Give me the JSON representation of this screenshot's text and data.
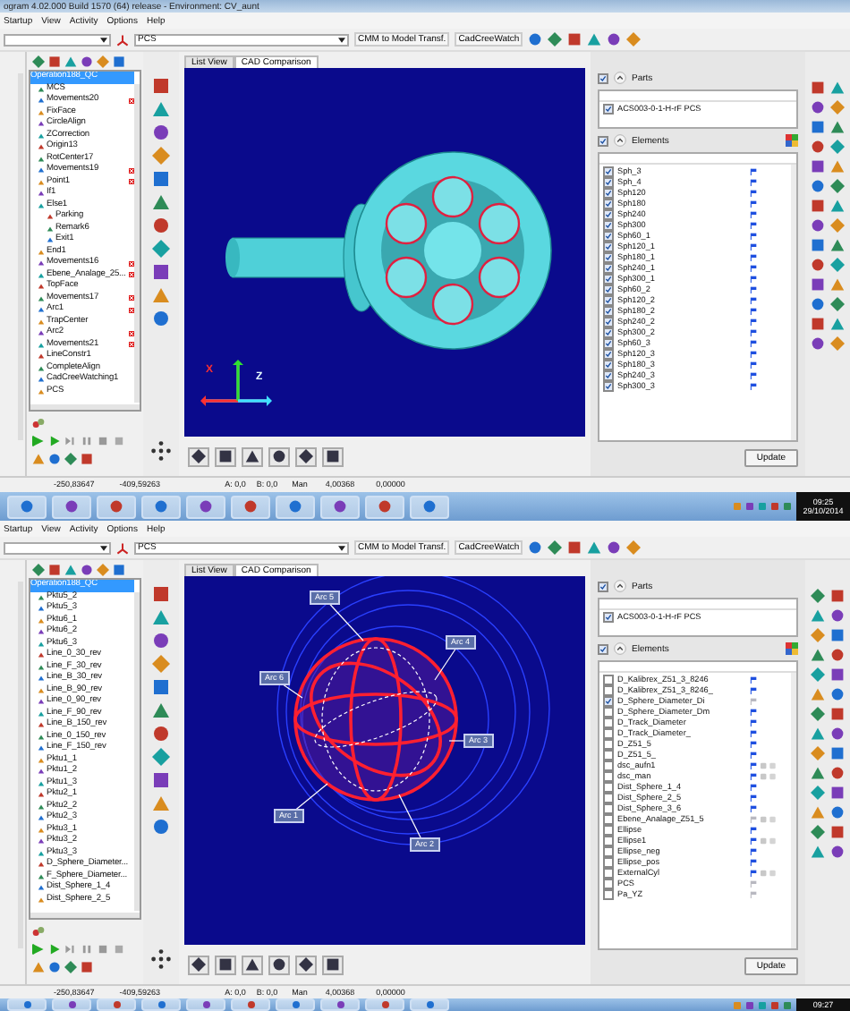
{
  "screens": [
    {
      "title": "ogram 4.02.000 Build 1570 (64) release - Environment: CV_aunt",
      "menu": [
        "Startup",
        "View",
        "Activity",
        "Options",
        "Help"
      ],
      "toolbar": {
        "coordinate_system": "PCS",
        "buttons": [
          "CMM to Model Transf.",
          "CadCreeWatch"
        ]
      },
      "tree": {
        "items": [
          {
            "label": "Operation188_QC",
            "selected": true,
            "warning": false,
            "children": [
              {
                "label": "MCS",
                "selected": false,
                "warning": false
              },
              {
                "label": "Movements20",
                "selected": false,
                "warning": true
              },
              {
                "label": "FixFace",
                "selected": false,
                "warning": false
              },
              {
                "label": "CircleAlign",
                "selected": false,
                "warning": false
              },
              {
                "label": "ZCorrection",
                "selected": false,
                "warning": false
              },
              {
                "label": "Origin13",
                "selected": false,
                "warning": false
              },
              {
                "label": "RotCenter17",
                "selected": false,
                "warning": false
              },
              {
                "label": "Movements19",
                "selected": false,
                "warning": true
              },
              {
                "label": "Point1",
                "selected": false,
                "warning": true
              },
              {
                "label": "If1",
                "selected": false,
                "warning": false
              },
              {
                "label": "Else1",
                "selected": false,
                "warning": false,
                "children": [
                  {
                    "label": "Parking",
                    "selected": false,
                    "warning": false
                  },
                  {
                    "label": "Remark6",
                    "selected": false,
                    "warning": false
                  },
                  {
                    "label": "Exit1",
                    "selected": false,
                    "warning": false
                  }
                ]
              },
              {
                "label": "End1",
                "selected": false,
                "warning": false
              },
              {
                "label": "Movements16",
                "selected": false,
                "warning": true
              },
              {
                "label": "Ebene_Analage_25...",
                "selected": false,
                "warning": true
              },
              {
                "label": "TopFace",
                "selected": false,
                "warning": false
              },
              {
                "label": "Movements17",
                "selected": false,
                "warning": true
              },
              {
                "label": "Arc1",
                "selected": false,
                "warning": true
              },
              {
                "label": "TrapCenter",
                "selected": false,
                "warning": false
              },
              {
                "label": "Arc2",
                "selected": false,
                "warning": true
              },
              {
                "label": "Movements21",
                "selected": false,
                "warning": true
              },
              {
                "label": "LineConstr1",
                "selected": false,
                "warning": false
              },
              {
                "label": "CompleteAlign",
                "selected": false,
                "warning": false
              },
              {
                "label": "CadCreeWatching1",
                "selected": false,
                "warning": false
              },
              {
                "label": "PCS",
                "selected": false,
                "warning": false
              }
            ]
          }
        ]
      },
      "tabs": [
        {
          "label": "List View",
          "selected": false
        },
        {
          "label": "CAD Comparison",
          "selected": true
        }
      ],
      "viewport": {
        "kind": "part",
        "labels": [
          "X",
          "Z"
        ]
      },
      "parts": {
        "label": "Parts",
        "checked": true,
        "items": [
          {
            "label": "ACS003-0-1-H-rF PCS",
            "checked": true
          }
        ]
      },
      "elements": {
        "label": "Elements",
        "checked": true,
        "items": [
          {
            "label": "Sph_3",
            "checked": true,
            "flag": true
          },
          {
            "label": "Sph_4",
            "checked": true,
            "flag": true
          },
          {
            "label": "Sph120",
            "checked": true,
            "flag": true
          },
          {
            "label": "Sph180",
            "checked": true,
            "flag": true
          },
          {
            "label": "Sph240",
            "checked": true,
            "flag": true
          },
          {
            "label": "Sph300",
            "checked": true,
            "flag": true
          },
          {
            "label": "Sph60_1",
            "checked": true,
            "flag": true
          },
          {
            "label": "Sph120_1",
            "checked": true,
            "flag": true
          },
          {
            "label": "Sph180_1",
            "checked": true,
            "flag": true
          },
          {
            "label": "Sph240_1",
            "checked": true,
            "flag": true
          },
          {
            "label": "Sph300_1",
            "checked": true,
            "flag": true
          },
          {
            "label": "Sph60_2",
            "checked": true,
            "flag": true
          },
          {
            "label": "Sph120_2",
            "checked": true,
            "flag": true
          },
          {
            "label": "Sph180_2",
            "checked": true,
            "flag": true
          },
          {
            "label": "Sph240_2",
            "checked": true,
            "flag": true
          },
          {
            "label": "Sph300_2",
            "checked": true,
            "flag": true
          },
          {
            "label": "Sph60_3",
            "checked": true,
            "flag": true
          },
          {
            "label": "Sph120_3",
            "checked": true,
            "flag": true
          },
          {
            "label": "Sph180_3",
            "checked": true,
            "flag": true
          },
          {
            "label": "Sph240_3",
            "checked": true,
            "flag": true
          },
          {
            "label": "Sph300_3",
            "checked": true,
            "flag": true
          }
        ]
      },
      "update_button": "Update",
      "status_bar": [
        "-250,83647",
        "-409,59263",
        "A: 0,0",
        "B: 0,0",
        "Man",
        "4,00368",
        "0,00000"
      ],
      "clock": {
        "time": "09:25",
        "date": "29/10/2014"
      }
    },
    {
      "menu": [
        "Startup",
        "View",
        "Activity",
        "Options",
        "Help"
      ],
      "toolbar": {
        "coordinate_system": "PCS",
        "buttons": [
          "CMM to Model Transf.",
          "CadCreeWatch"
        ]
      },
      "tree": {
        "items": [
          {
            "label": "Operation188_QC",
            "selected": true,
            "warning": false,
            "children": [
              {
                "label": "Pktu5_2",
                "selected": false,
                "warning": false
              },
              {
                "label": "Pktu5_3",
                "selected": false,
                "warning": false
              },
              {
                "label": "Pktu6_1",
                "selected": false,
                "warning": false
              },
              {
                "label": "Pktu6_2",
                "selected": false,
                "warning": false
              },
              {
                "label": "Pktu6_3",
                "selected": false,
                "warning": false
              },
              {
                "label": "Line_0_30_rev",
                "selected": false,
                "warning": false
              },
              {
                "label": "Line_F_30_rev",
                "selected": false,
                "warning": false
              },
              {
                "label": "Line_B_30_rev",
                "selected": false,
                "warning": false
              },
              {
                "label": "Line_B_90_rev",
                "selected": false,
                "warning": false
              },
              {
                "label": "Line_0_90_rev",
                "selected": false,
                "warning": false
              },
              {
                "label": "Line_F_90_rev",
                "selected": false,
                "warning": false
              },
              {
                "label": "Line_B_150_rev",
                "selected": false,
                "warning": false
              },
              {
                "label": "Line_0_150_rev",
                "selected": false,
                "warning": false
              },
              {
                "label": "Line_F_150_rev",
                "selected": false,
                "warning": false
              },
              {
                "label": "Pktu1_1",
                "selected": false,
                "warning": false
              },
              {
                "label": "Pktu1_2",
                "selected": false,
                "warning": false
              },
              {
                "label": "Pktu1_3",
                "selected": false,
                "warning": false
              },
              {
                "label": "Pktu2_1",
                "selected": false,
                "warning": false
              },
              {
                "label": "Pktu2_2",
                "selected": false,
                "warning": false
              },
              {
                "label": "Pktu2_3",
                "selected": false,
                "warning": false
              },
              {
                "label": "Pktu3_1",
                "selected": false,
                "warning": false
              },
              {
                "label": "Pktu3_2",
                "selected": false,
                "warning": false
              },
              {
                "label": "Pktu3_3",
                "selected": false,
                "warning": false
              },
              {
                "label": "D_Sphere_Diameter...",
                "selected": false,
                "warning": false
              },
              {
                "label": "F_Sphere_Diameter...",
                "selected": false,
                "warning": false
              },
              {
                "label": "Dist_Sphere_1_4",
                "selected": false,
                "warning": false
              },
              {
                "label": "Dist_Sphere_2_5",
                "selected": false,
                "warning": false
              }
            ]
          }
        ]
      },
      "tabs": [
        {
          "label": "List View",
          "selected": false
        },
        {
          "label": "CAD Comparison",
          "selected": true
        }
      ],
      "viewport": {
        "kind": "arcs",
        "labels": [
          "Arc 5",
          "Arc 4",
          "Arc 6",
          "Arc 3",
          "Arc 1",
          "Arc 2"
        ]
      },
      "parts": {
        "label": "Parts",
        "checked": true,
        "items": [
          {
            "label": "ACS003-0-1-H-rF PCS",
            "checked": true
          }
        ]
      },
      "elements": {
        "label": "Elements",
        "checked": true,
        "items": [
          {
            "label": "D_Kalibrex_Z51_3_8246",
            "checked": false,
            "flag": true,
            "extras": false
          },
          {
            "label": "D_Kalibrex_Z51_3_8246_",
            "checked": false,
            "flag": true,
            "extras": false
          },
          {
            "label": "D_Sphere_Diameter_Di",
            "checked": true,
            "flag": false,
            "extras": false
          },
          {
            "label": "D_Sphere_Diameter_Dm",
            "checked": false,
            "flag": true,
            "extras": false
          },
          {
            "label": "D_Track_Diameter",
            "checked": false,
            "flag": true,
            "extras": false
          },
          {
            "label": "D_Track_Diameter_",
            "checked": false,
            "flag": true,
            "extras": false
          },
          {
            "label": "D_Z51_5",
            "checked": false,
            "flag": true,
            "extras": false
          },
          {
            "label": "D_Z51_5_",
            "checked": false,
            "flag": true,
            "extras": false
          },
          {
            "label": "dsc_aufn1",
            "checked": false,
            "flag": true,
            "extras": true
          },
          {
            "label": "dsc_man",
            "checked": false,
            "flag": true,
            "extras": true
          },
          {
            "label": "Dist_Sphere_1_4",
            "checked": false,
            "flag": true,
            "extras": false
          },
          {
            "label": "Dist_Sphere_2_5",
            "checked": false,
            "flag": true,
            "extras": false
          },
          {
            "label": "Dist_Sphere_3_6",
            "checked": false,
            "flag": true,
            "extras": false
          },
          {
            "label": "Ebene_Analage_Z51_5",
            "checked": false,
            "flag": false,
            "extras": true
          },
          {
            "label": "Ellipse",
            "checked": false,
            "flag": true,
            "extras": false
          },
          {
            "label": "Ellipse1",
            "checked": false,
            "flag": true,
            "extras": true
          },
          {
            "label": "Ellipse_neg",
            "checked": false,
            "flag": true,
            "extras": false
          },
          {
            "label": "Ellipse_pos",
            "checked": false,
            "flag": true,
            "extras": false
          },
          {
            "label": "ExternalCyl",
            "checked": false,
            "flag": true,
            "extras": true
          },
          {
            "label": "PCS",
            "checked": false,
            "flag": false,
            "extras": false
          },
          {
            "label": "Pa_YZ",
            "checked": false,
            "flag": false,
            "extras": false
          }
        ]
      },
      "update_button": "Update",
      "status_bar": [
        "-250,83647",
        "-409,59263",
        "A: 0,0",
        "B: 0,0",
        "Man",
        "4,00368",
        "0,00000"
      ],
      "clock": {
        "time": "09:27"
      }
    }
  ]
}
